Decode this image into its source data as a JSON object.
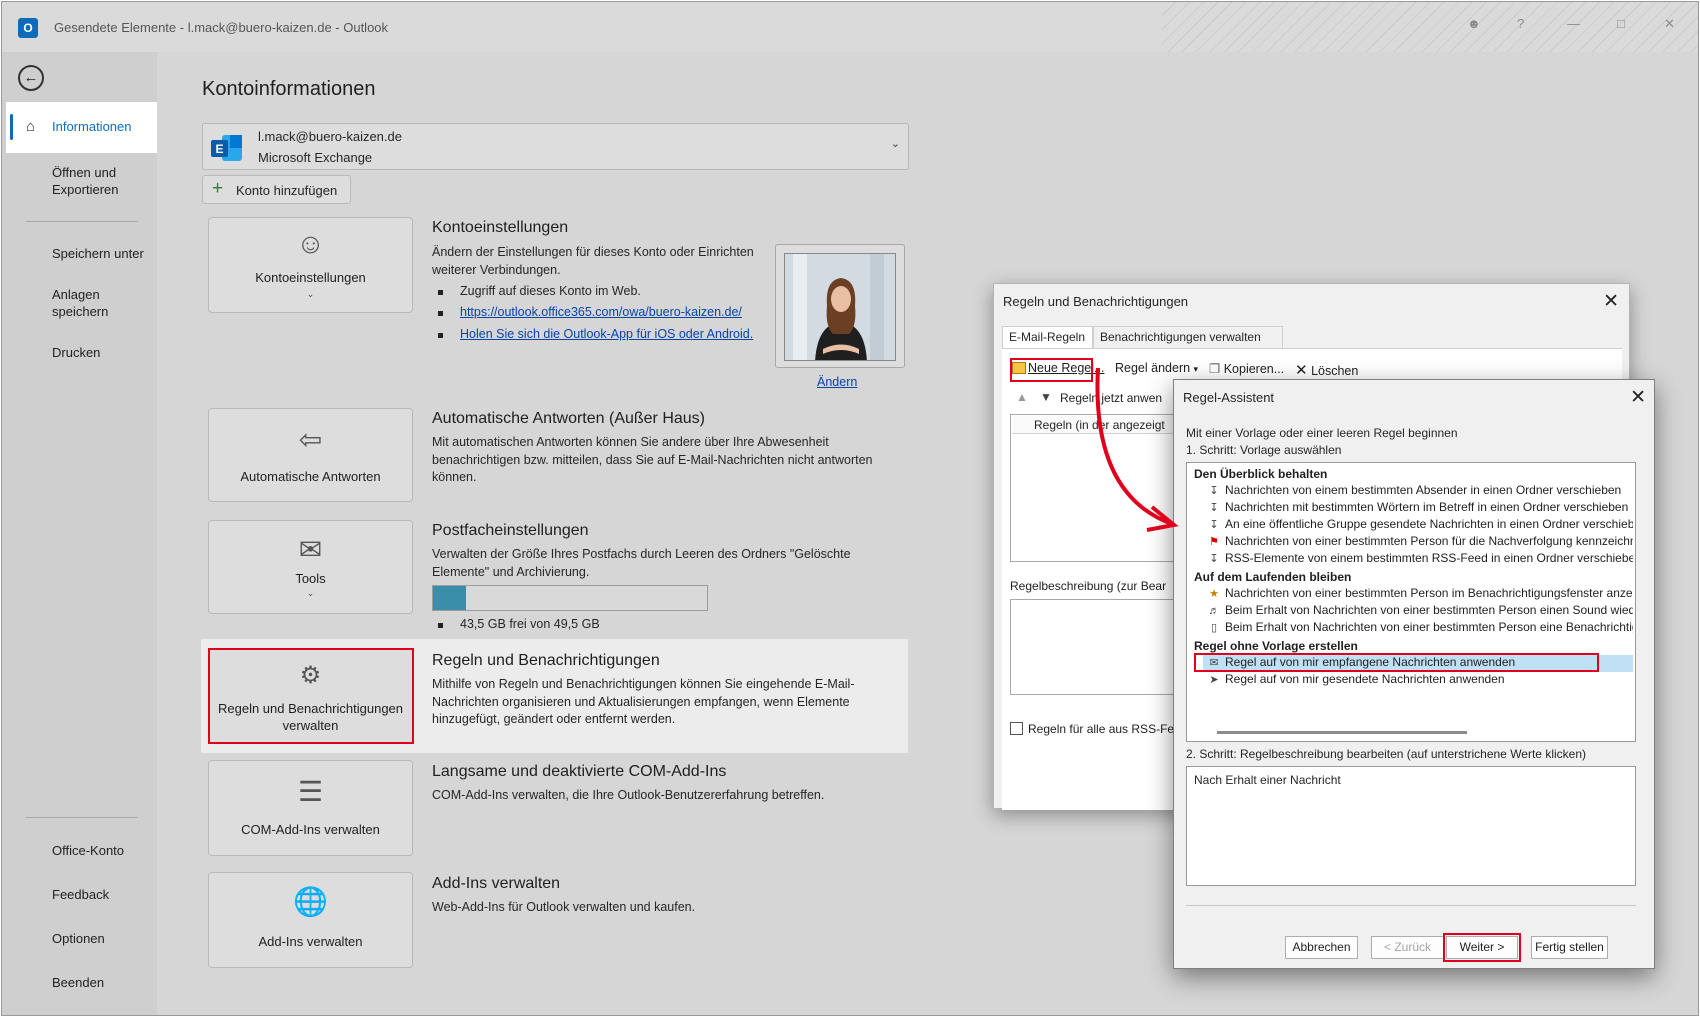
{
  "window": {
    "title": "Gesendete Elemente - l.mack@buero-kaizen.de  -  Outlook",
    "logo_letter": "O"
  },
  "sidebar": {
    "selected": "Informationen",
    "items": [
      "Öffnen und Exportieren",
      "Speichern unter",
      "Anlagen speichern",
      "Drucken"
    ],
    "bottom": [
      "Office-Konto",
      "Feedback",
      "Optionen",
      "Beenden"
    ]
  },
  "main": {
    "heading": "Kontoinformationen",
    "account": {
      "email": "l.mack@buero-kaizen.de",
      "type": "Microsoft Exchange"
    },
    "add_account": "Konto hinzufügen",
    "sections": [
      {
        "tile": "Kontoeinstellungen",
        "title": "Kontoeinstellungen",
        "text": "Ändern der Einstellungen für dieses Konto oder Einrichten weiterer Verbindungen.",
        "bullet1": "Zugriff auf dieses Konto im Web.",
        "link1": "https://outlook.office365.com/owa/buero-kaizen.de/",
        "link2": "Holen Sie sich die Outlook-App für iOS oder Android.",
        "photo_link": "Ändern"
      },
      {
        "tile": "Automatische Antworten",
        "title": "Automatische Antworten (Außer Haus)",
        "text": "Mit automatischen Antworten können Sie andere über Ihre Abwesenheit benachrichtigen bzw. mitteilen, dass Sie auf E-Mail-Nachrichten nicht antworten können."
      },
      {
        "tile": "Tools",
        "title": "Postfacheinstellungen",
        "text": "Verwalten der Größe Ihres Postfachs durch Leeren des Ordners \"Gelöschte Elemente\" und Archivierung.",
        "storage": "43,5 GB frei von 49,5 GB",
        "storage_used_fraction": 0.12
      },
      {
        "tile": "Regeln und Benachrichtigungen verwalten",
        "title": "Regeln und Benachrichtigungen",
        "text": "Mithilfe von Regeln und Benachrichtigungen können Sie eingehende E-Mail-Nachrichten organisieren und Aktualisierungen empfangen, wenn Elemente hinzugefügt, geändert oder entfernt werden."
      },
      {
        "tile": "COM-Add-Ins verwalten",
        "title": "Langsame und deaktivierte COM-Add-Ins",
        "text": "COM-Add-Ins verwalten, die Ihre Outlook-Benutzererfahrung betreffen."
      },
      {
        "tile": "Add-Ins verwalten",
        "title": "Add-Ins verwalten",
        "text": "Web-Add-Ins für Outlook verwalten und kaufen."
      }
    ]
  },
  "rules_dialog": {
    "title": "Regeln und Benachrichtigungen",
    "tabs": [
      "E-Mail-Regeln",
      "Benachrichtigungen verwalten"
    ],
    "toolbar": {
      "new": "Neue Regel...",
      "change": "Regel ändern",
      "copy": "Kopieren...",
      "delete": "Löschen"
    },
    "apply_now": "Regeln jetzt anwen",
    "column": "Regeln (in der angezeigt",
    "description_label": "Regelbeschreibung (zur Bear",
    "rss_checkbox": "Regeln für alle aus RSS-Fe"
  },
  "wizard": {
    "title": "Regel-Assistent",
    "intro": "Mit einer Vorlage oder einer leeren Regel beginnen",
    "step1": "1. Schritt: Vorlage auswählen",
    "groups": [
      {
        "name": "Den Überblick behalten",
        "items": [
          "Nachrichten von einem bestimmten Absender in einen Ordner verschieben",
          "Nachrichten mit bestimmten Wörtern im Betreff in einen Ordner verschieben",
          "An eine öffentliche Gruppe gesendete Nachrichten in einen Ordner verschieben",
          "Nachrichten von einer bestimmten Person für die Nachverfolgung kennzeichnen",
          "RSS-Elemente von einem bestimmten RSS-Feed in einen Ordner verschieben"
        ]
      },
      {
        "name": "Auf dem Laufenden bleiben",
        "items": [
          "Nachrichten von einer bestimmten Person im Benachrichtigungsfenster anzeigen",
          "Beim Erhalt von Nachrichten von einer bestimmten Person einen Sound wiedergeben",
          "Beim Erhalt von Nachrichten von einer bestimmten Person eine Benachrichtigung senden"
        ]
      },
      {
        "name": "Regel ohne Vorlage erstellen",
        "items": [
          "Regel auf von mir empfangene Nachrichten anwenden",
          "Regel auf von mir gesendete Nachrichten anwenden"
        ]
      }
    ],
    "selected_item": "Regel auf von mir empfangene Nachrichten anwenden",
    "step2": "2. Schritt: Regelbeschreibung bearbeiten (auf unterstrichene Werte klicken)",
    "description": "Nach Erhalt einer Nachricht",
    "buttons": {
      "cancel": "Abbrechen",
      "back": "< Zurück",
      "next": "Weiter >",
      "finish": "Fertig stellen"
    }
  },
  "colors": {
    "accent": "#0f6cbd",
    "highlight": "#e0001b",
    "selection": "#bfe0f5"
  }
}
